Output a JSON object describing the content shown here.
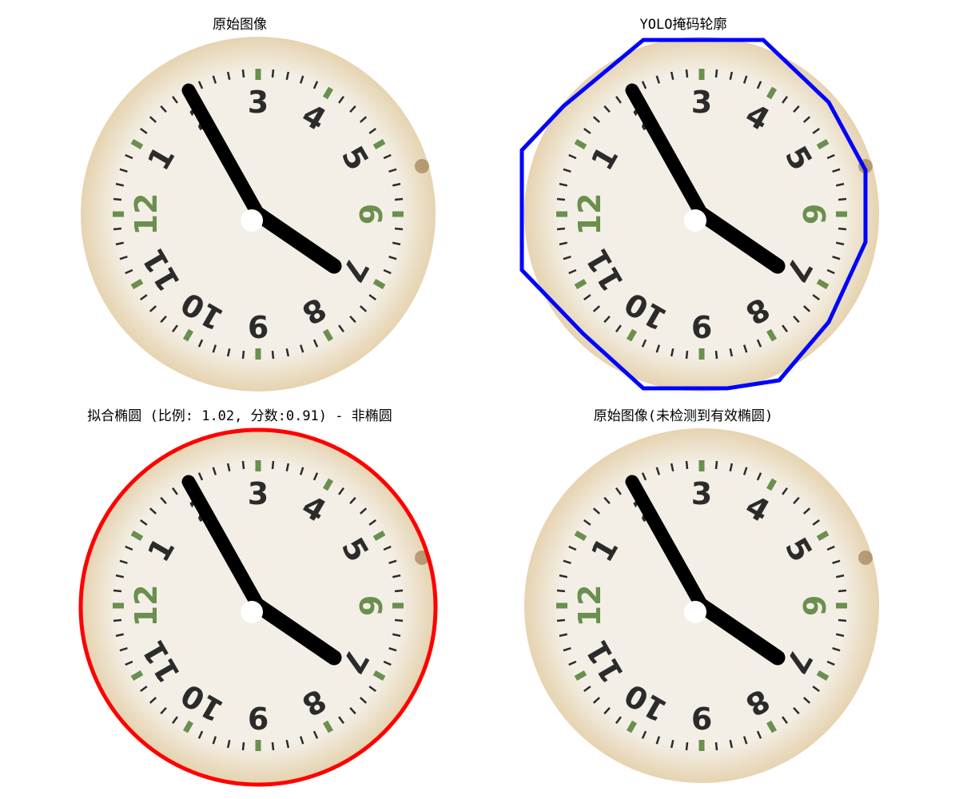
{
  "panels": [
    {
      "title": "原始图像",
      "overlay": "none"
    },
    {
      "title": "YOLO掩码轮廓",
      "overlay": "polygon",
      "overlay_color": "#0000ff"
    },
    {
      "title": "拟合椭圆 (比例: 1.02, 分数:0.91) - 非椭圆",
      "overlay": "ellipse",
      "overlay_color": "#ff0000"
    },
    {
      "title": "原始图像(未检测到有效椭圆)",
      "overlay": "none"
    }
  ],
  "clock": {
    "numerals": [
      "3",
      "4",
      "5",
      "6",
      "7",
      "8",
      "9",
      "10",
      "11",
      "12",
      "1",
      "2"
    ],
    "numeral_color": "#2b2b2b",
    "accent_color": "#6b8f4e",
    "face_color": "#f3efe6",
    "rim_color": "#e6d3b0",
    "hand_color": "#000000"
  }
}
